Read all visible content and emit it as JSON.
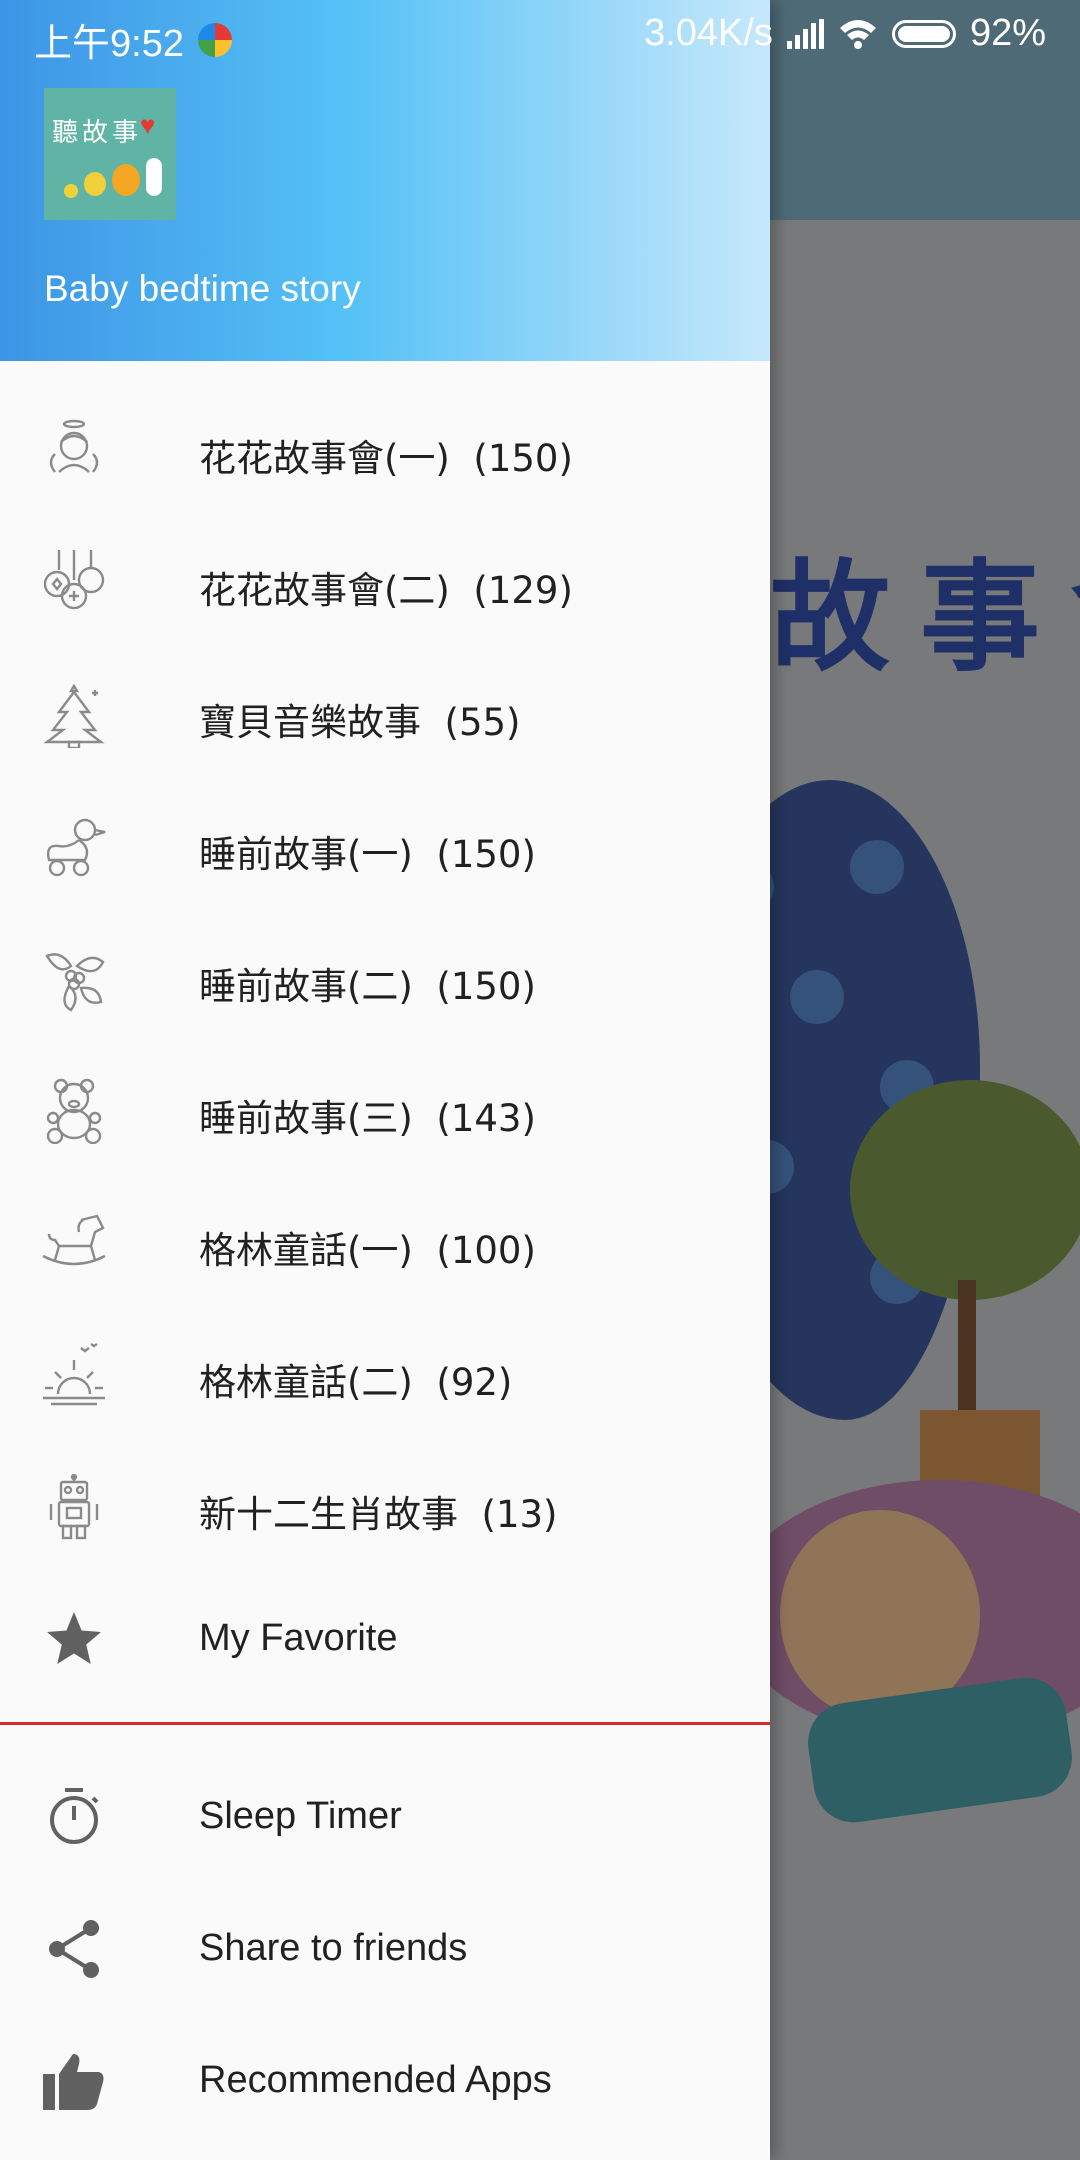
{
  "status_bar": {
    "time": "上午9:52",
    "net_speed": "3.04K/s",
    "battery": "92%"
  },
  "drawer": {
    "header_title": "Baby bedtime story",
    "logo": {
      "text": "聽故事",
      "icon": "app-logo-chicks"
    },
    "categories": [
      {
        "label": "花花故事會(一)  (150)",
        "icon": "angel-icon"
      },
      {
        "label": "花花故事會(二)  (129)",
        "icon": "ornaments-icon"
      },
      {
        "label": "寶貝音樂故事  (55)",
        "icon": "christmas-tree-icon"
      },
      {
        "label": "睡前故事(一)  (150)",
        "icon": "duck-toy-icon"
      },
      {
        "label": "睡前故事(二)  (150)",
        "icon": "holly-icon"
      },
      {
        "label": "睡前故事(三)  (143)",
        "icon": "teddy-bear-icon"
      },
      {
        "label": "格林童話(一)  (100)",
        "icon": "rocking-horse-icon"
      },
      {
        "label": "格林童話(二)  (92)",
        "icon": "sunrise-icon"
      },
      {
        "label": "新十二生肖故事  (13)",
        "icon": "robot-icon"
      }
    ],
    "favorite": {
      "label": "My Favorite",
      "icon": "star-icon"
    },
    "extras": [
      {
        "label": "Sleep Timer",
        "icon": "timer-icon"
      },
      {
        "label": "Share to friends",
        "icon": "share-icon"
      },
      {
        "label": "Recommended Apps",
        "icon": "thumbs-up-icon"
      }
    ],
    "divider_color": "#d32f2f"
  },
  "background": {
    "title_glyphs": "故事會"
  },
  "colors": {
    "header_gradient_start": "#3d95e5",
    "header_gradient_end": "#c7e8fb",
    "text": "#212121",
    "icon_gray": "#757575"
  }
}
